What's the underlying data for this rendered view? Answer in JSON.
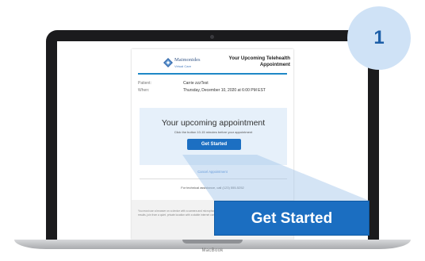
{
  "step": {
    "number": "1"
  },
  "email": {
    "brand_name": "Maimonides",
    "brand_sub": "Virtual Care",
    "header_title": "Your Upcoming Telehealth Appointment",
    "patient_label": "Patient:",
    "patient_value": "Carrie zzzTest",
    "when_label": "When:",
    "when_value": "Thursday, December 10, 2020 at 6:00 PM EST",
    "cta_title": "Your upcoming appointment",
    "cta_hint": "Click the button 10-15 minutes before your appointment",
    "button_label": "Get Started",
    "cancel_link": "Cancel Appointment",
    "tech_help": "For technical assistance, call (123) 555-5252",
    "footer_text": "You must use a browser on a device with a camera and microphone. For best results, join from a quiet, private location with a stable internet connection."
  },
  "callout": {
    "label": "Get Started"
  },
  "laptop": {
    "brand": "MacBook"
  },
  "colors": {
    "accent_blue": "#1b6ec1",
    "header_rule": "#1e88c7",
    "cta_background": "#e6f0fa",
    "badge_background": "#cfe2f6",
    "badge_text": "#1d5fa8"
  },
  "icons": {
    "logo": "maimonides-logo-icon"
  }
}
